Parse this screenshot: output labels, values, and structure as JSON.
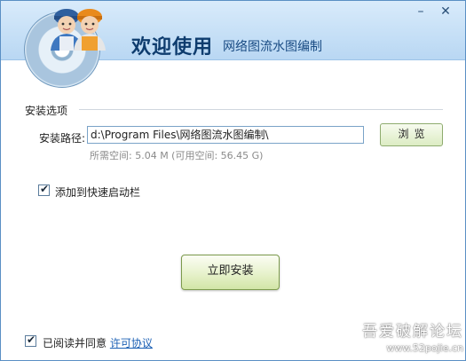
{
  "header": {
    "title_main": "欢迎使用",
    "title_sub": "网络图流水图编制",
    "minimize_label": "–",
    "close_label": "✕",
    "logo_icon": "installer-workers-disc-icon"
  },
  "install_options": {
    "section_label": "安装选项",
    "path_label": "安装路径:",
    "path_value": "d:\\Program Files\\网络图流水图编制\\",
    "browse_label": "浏览",
    "space_info": "所需空间: 5.04 M (可用空间: 56.45 G)",
    "quick_launch_label": "添加到快速启动栏",
    "quick_launch_checked": true
  },
  "actions": {
    "install_label": "立即安装"
  },
  "footer": {
    "agree_label": "已阅读并同意",
    "agree_link": "许可协议",
    "agree_checked": true
  },
  "watermark": {
    "line1": "吾爱破解论坛",
    "line2": "www.52pojie.cn"
  },
  "colors": {
    "header_bg": "#c5dff6",
    "title": "#0e3c6e",
    "button_green": "#dcecc3",
    "link": "#1a5fb4"
  }
}
